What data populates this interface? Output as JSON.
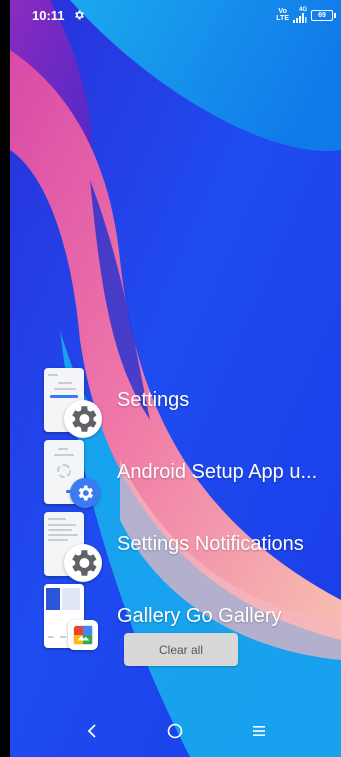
{
  "status_bar": {
    "time": "10:11",
    "volte_top": "Vo",
    "volte_bottom": "LTE",
    "network": "4G",
    "battery": "69",
    "icons": [
      "settings-gear-icon",
      "volte-icon",
      "signal-icon",
      "battery-icon"
    ]
  },
  "recents": {
    "items": [
      {
        "label": "Settings",
        "icon": "gear-icon"
      },
      {
        "label": "Android Setup App u...",
        "icon": "blue-gear-icon"
      },
      {
        "label": "Settings Notifications",
        "icon": "gear-icon"
      },
      {
        "label": "Gallery Go Gallery",
        "icon": "gallery-go-icon"
      }
    ],
    "clear_all_label": "Clear all"
  },
  "nav_bar": {
    "back_icon": "back-chevron-icon",
    "home_icon": "home-circle-icon",
    "recents_icon": "menu-lines-icon"
  },
  "colors": {
    "wallpaper_blue": "#1a3cf0",
    "wallpaper_cyan": "#16b8ee",
    "ribbon_pink": "#f07aa8",
    "ribbon_purple": "#7a2fb8",
    "accent_blue": "#3a7bf2"
  }
}
